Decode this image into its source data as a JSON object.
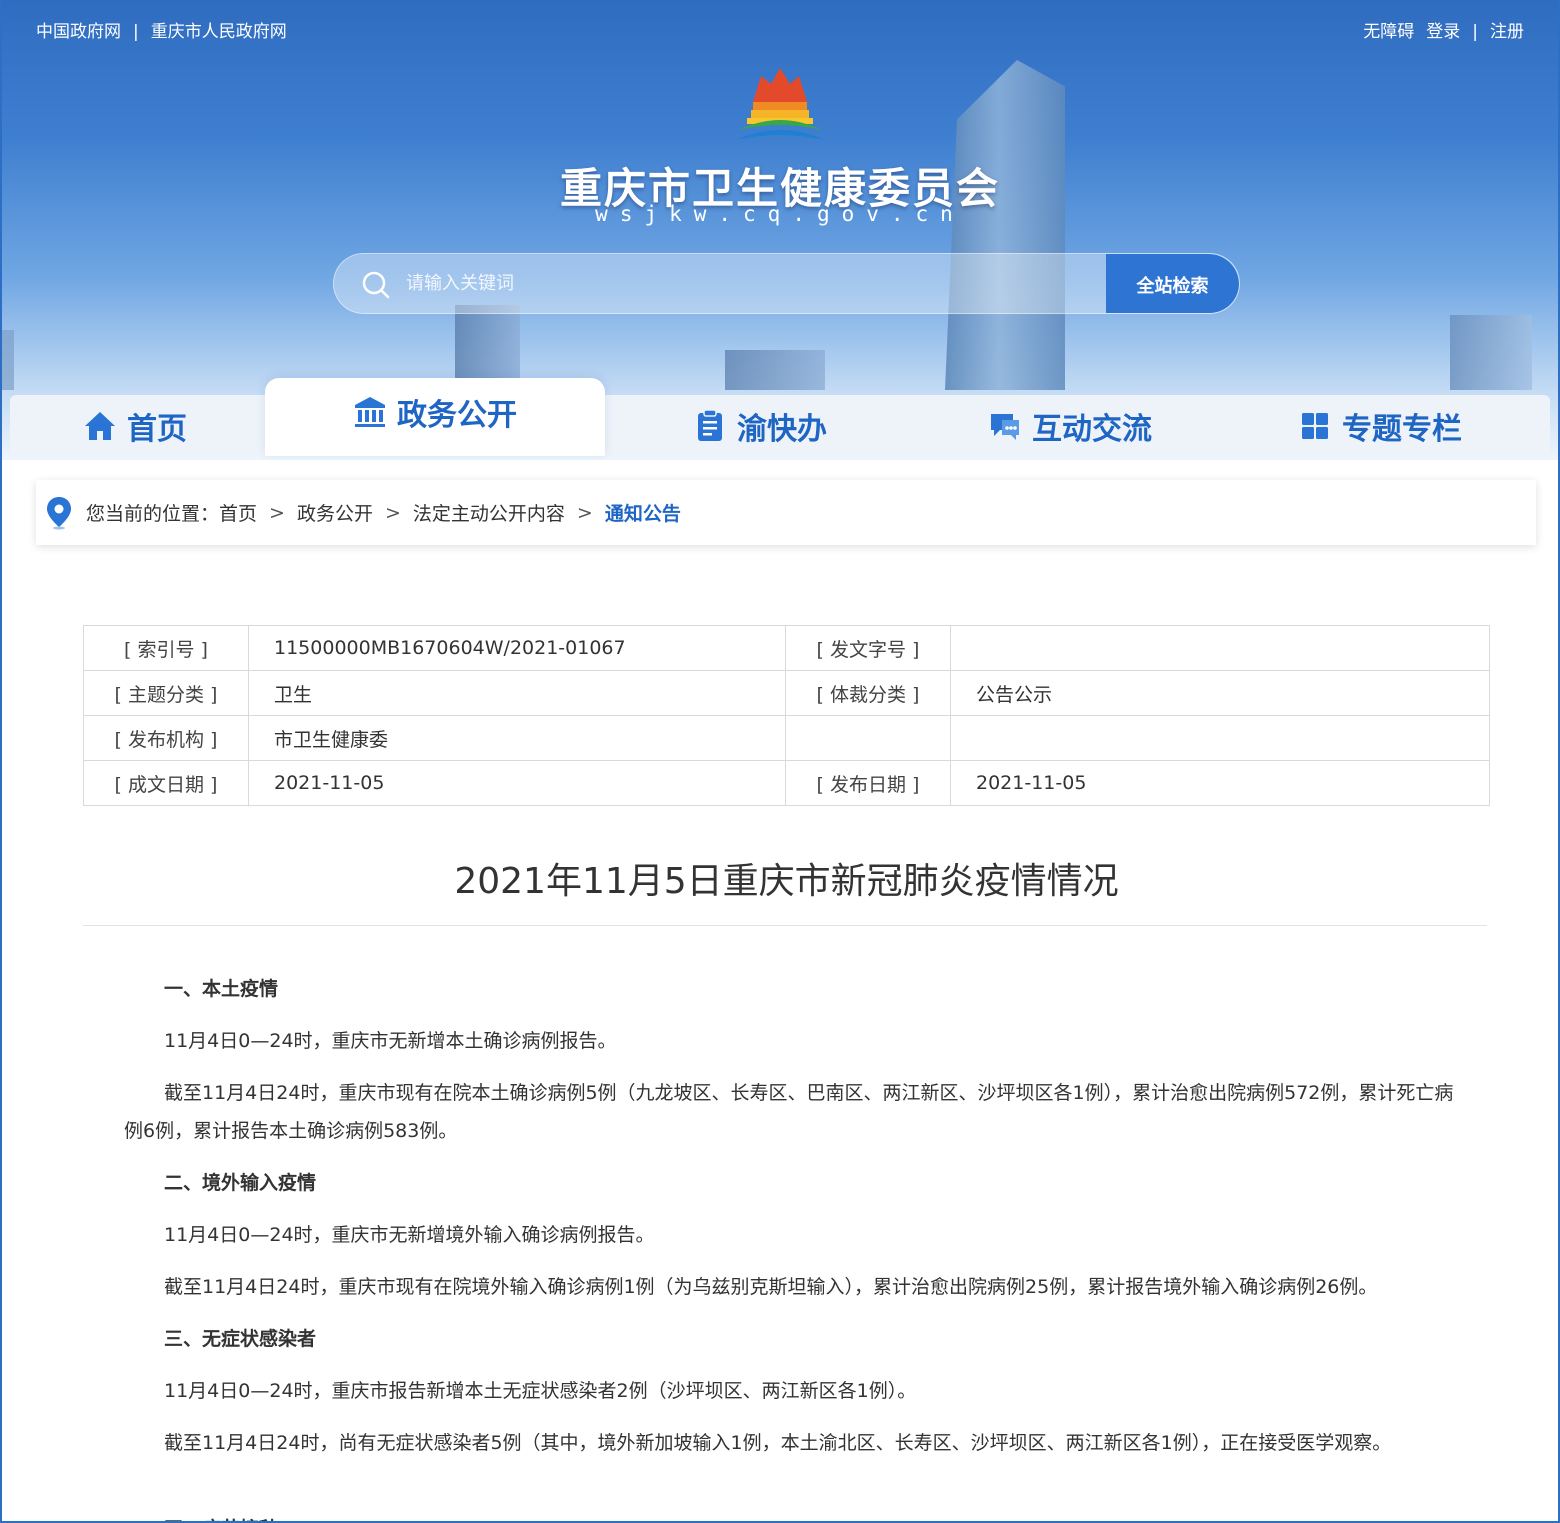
{
  "top_links": {
    "gov_cn": "中国政府网",
    "separator": "|",
    "cq_gov": "重庆市人民政府网",
    "accessibility": "无障碍",
    "login": "登录",
    "register": "注册"
  },
  "site": {
    "title": "重庆市卫生健康委员会",
    "domain": "wsjkw.cq.gov.cn"
  },
  "search": {
    "placeholder": "请输入关键词",
    "button": "全站检索"
  },
  "nav": {
    "tabs": [
      {
        "label": "首页",
        "icon": "home-icon"
      },
      {
        "label": "政务公开",
        "icon": "government-building-icon",
        "active": true
      },
      {
        "label": "渝快办",
        "icon": "clipboard-icon"
      },
      {
        "label": "互动交流",
        "icon": "chat-icon"
      },
      {
        "label": "专题专栏",
        "icon": "grid-icon"
      }
    ]
  },
  "breadcrumb": {
    "prefix": "您当前的位置：",
    "items": [
      "首页",
      "政务公开",
      "法定主动公开内容"
    ],
    "current": "通知公告",
    "arrow": ">"
  },
  "meta": {
    "index_no_label": "[ 索引号 ]",
    "index_no": "11500000MB1670604W/2021-01067",
    "doc_no_label": "[ 发文字号 ]",
    "doc_no": "",
    "topic_label": "[ 主题分类 ]",
    "topic": "卫生",
    "genre_label": "[ 体裁分类 ]",
    "genre": "公告公示",
    "publisher_label": "[ 发布机构 ]",
    "publisher": "市卫生健康委",
    "created_label": "[ 成文日期 ]",
    "created": "2021-11-05",
    "published_label": "[ 发布日期 ]",
    "published": "2021-11-05"
  },
  "article": {
    "title": "2021年11月5日重庆市新冠肺炎疫情情况",
    "paragraphs": [
      {
        "heading": true,
        "text": "一、本土疫情"
      },
      {
        "heading": false,
        "text": "11月4日0—24时，重庆市无新增本土确诊病例报告。"
      },
      {
        "heading": false,
        "text": "截至11月4日24时，重庆市现有在院本土确诊病例5例（九龙坡区、长寿区、巴南区、两江新区、沙坪坝区各1例），累计治愈出院病例572例，累计死亡病例6例，累计报告本土确诊病例583例。"
      },
      {
        "heading": true,
        "text": "二、境外输入疫情"
      },
      {
        "heading": false,
        "text": "11月4日0—24时，重庆市无新增境外输入确诊病例报告。"
      },
      {
        "heading": false,
        "text": "截至11月4日24时，重庆市现有在院境外输入确诊病例1例（为乌兹别克斯坦输入），累计治愈出院病例25例，累计报告境外输入确诊病例26例。"
      },
      {
        "heading": true,
        "text": "三、无症状感染者"
      },
      {
        "heading": false,
        "text": "11月4日0—24时，重庆市报告新增本土无症状感染者2例（沙坪坝区、两江新区各1例）。"
      },
      {
        "heading": false,
        "text": "截至11月4日24时，尚有无症状感染者5例（其中，境外新加坡输入1例，本土渝北区、长寿区、沙坪坝区、两江新区各1例），正在接受医学观察。"
      }
    ],
    "cut_heading": "四、疫苗接种"
  },
  "colors": {
    "brand_blue": "#1f65c4",
    "search_button": "#2e74d3"
  }
}
